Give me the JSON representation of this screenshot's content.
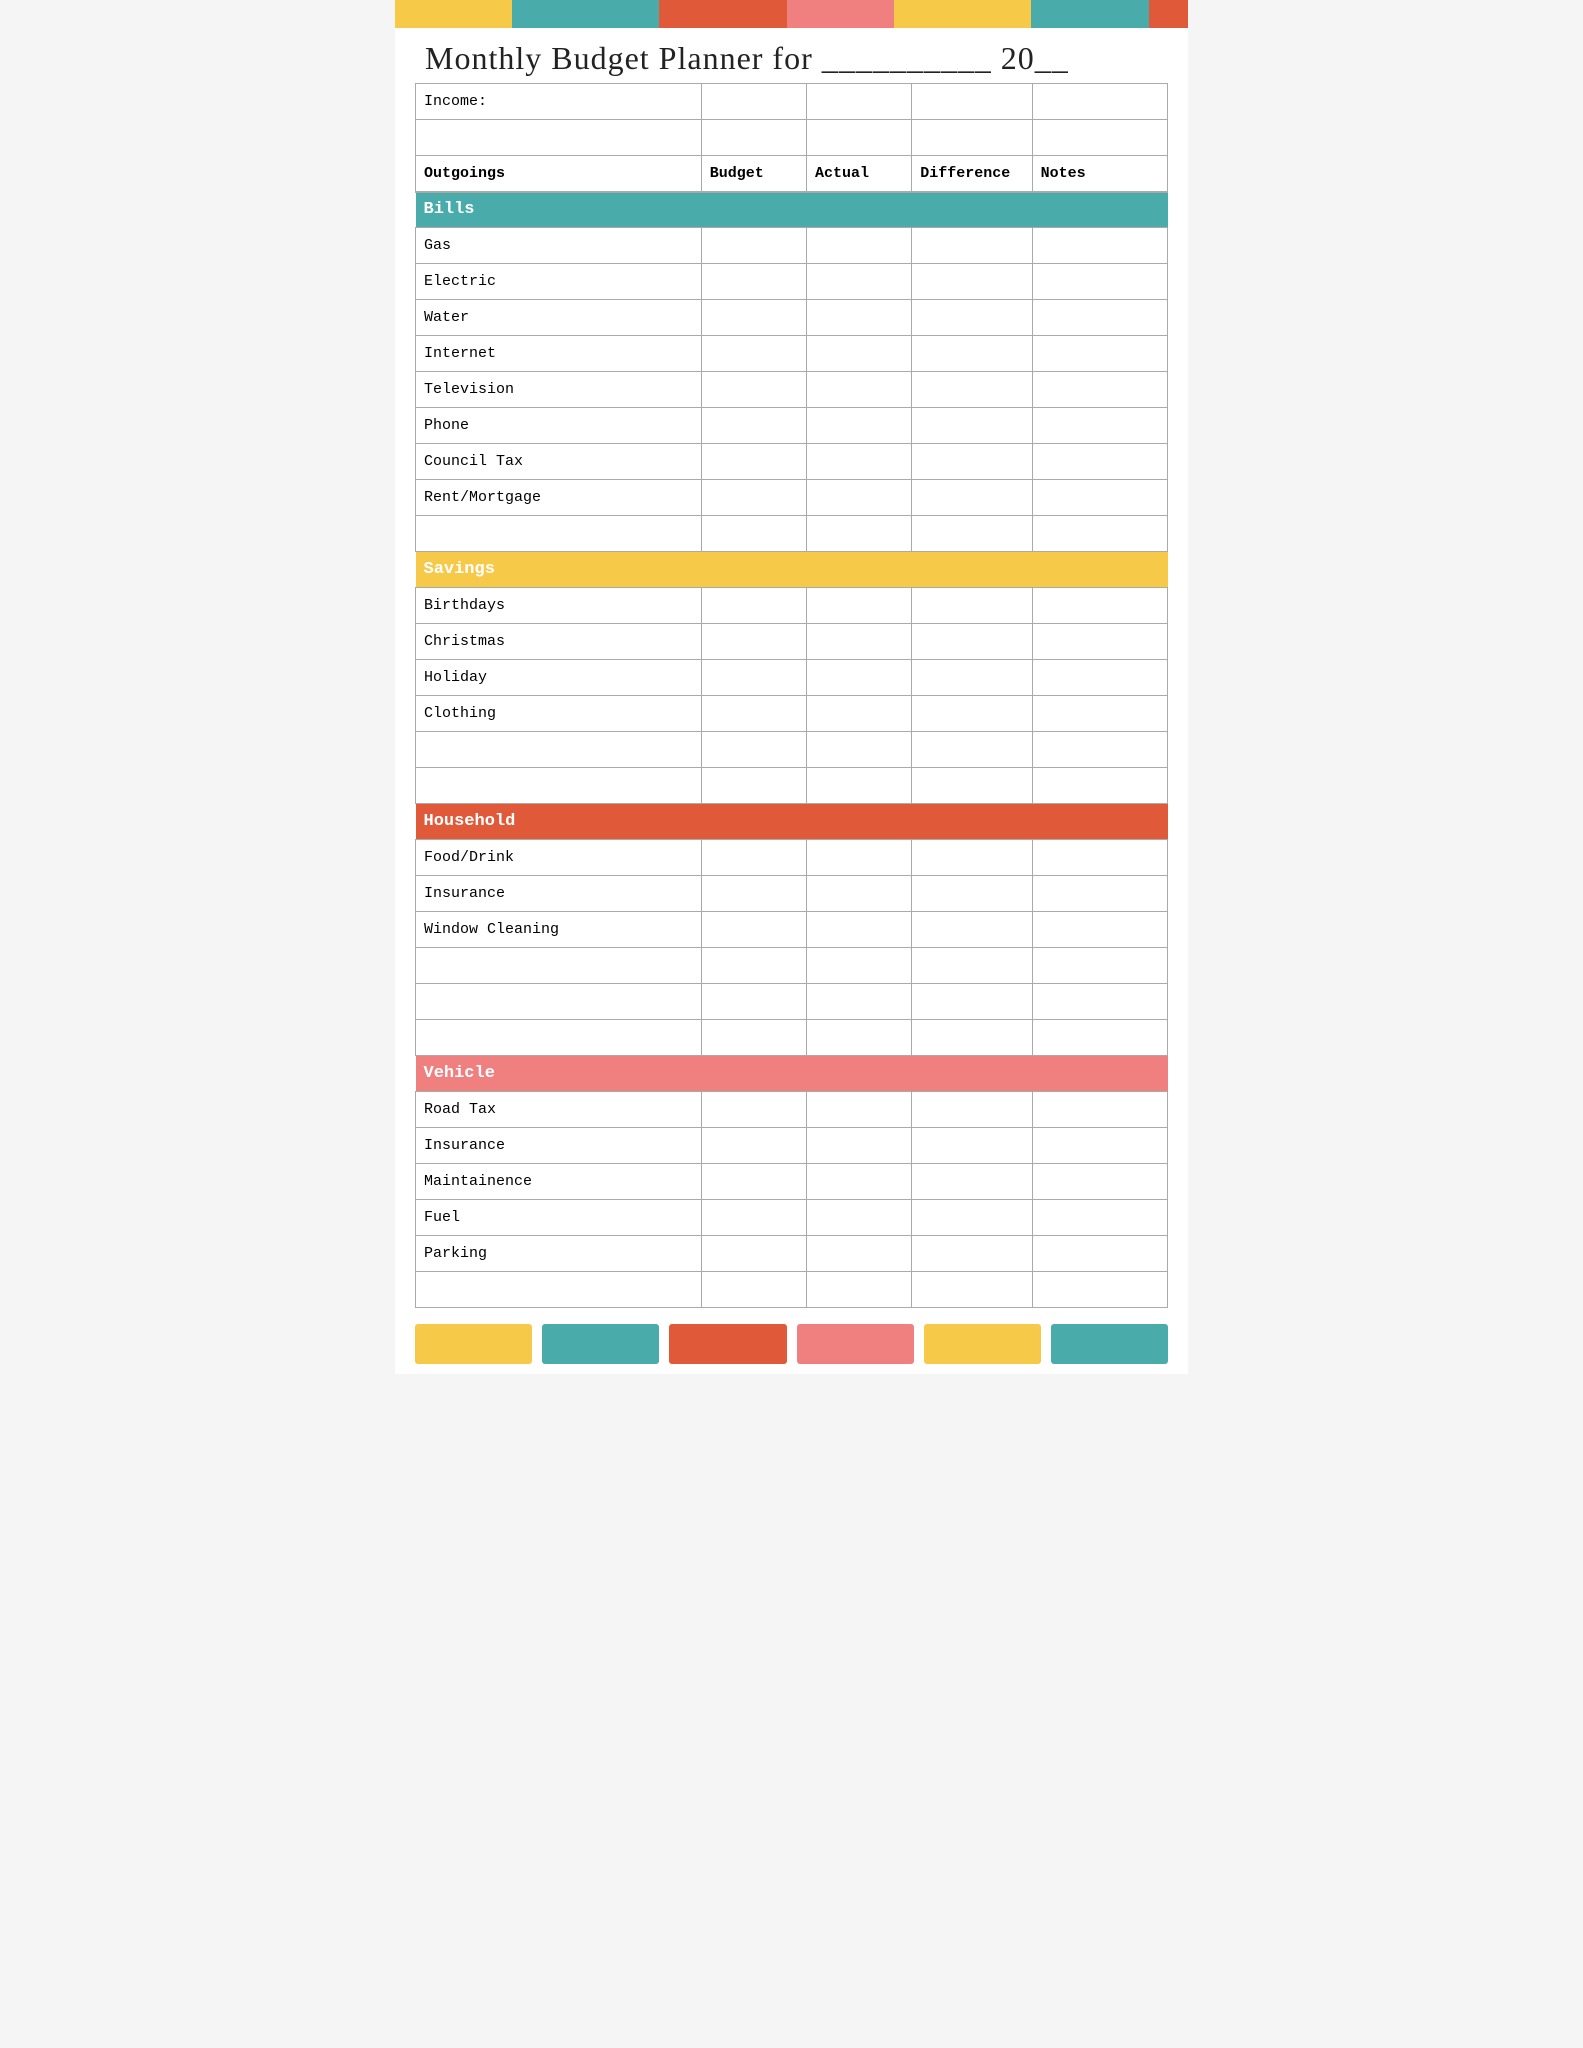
{
  "title": "Monthly Budget Planner for __________ 20__",
  "columns": {
    "label": "Outgoings",
    "budget": "Budget",
    "actual": "Actual",
    "difference": "Difference",
    "notes": "Notes"
  },
  "income": {
    "label": "Income:"
  },
  "sections": [
    {
      "name": "Bills",
      "color": "bills",
      "items": [
        "Gas",
        "Electric",
        "Water",
        "Internet",
        "Television",
        "Phone",
        "Council Tax",
        "Rent/Mortgage",
        ""
      ]
    },
    {
      "name": "Savings",
      "color": "savings",
      "items": [
        "Birthdays",
        "Christmas",
        "Holiday",
        "Clothing",
        "",
        ""
      ]
    },
    {
      "name": "Household",
      "color": "household",
      "items": [
        "Food/Drink",
        "Insurance",
        "Window Cleaning",
        "",
        "",
        ""
      ]
    },
    {
      "name": "Vehicle",
      "color": "vehicle",
      "items": [
        "Road Tax",
        "Insurance",
        "Maintainence",
        "Fuel",
        "Parking",
        ""
      ]
    }
  ]
}
